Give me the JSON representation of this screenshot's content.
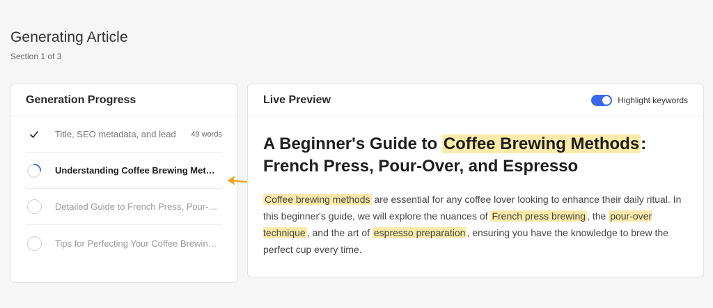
{
  "header": {
    "title": "Generating Article",
    "subtitle": "Section 1 of 3"
  },
  "progress": {
    "title": "Generation Progress",
    "steps": [
      {
        "label": "Title, SEO metadata, and lead",
        "status": "done",
        "count": "49 words",
        "icon": "check-icon"
      },
      {
        "label": "Understanding Coffee Brewing Met…",
        "status": "active",
        "icon": "spinner-icon"
      },
      {
        "label": "Detailed Guide to French Press, Pour-O…",
        "status": "pending",
        "icon": "empty-circle-icon"
      },
      {
        "label": "Tips for Perfecting Your Coffee Brewin…",
        "status": "pending",
        "icon": "empty-circle-icon"
      }
    ]
  },
  "preview": {
    "title": "Live Preview",
    "toggle": {
      "label": "Highlight keywords",
      "on": true,
      "color": "#3b68e8"
    },
    "article": {
      "title_pre": "A Beginner's Guide to ",
      "title_kw": "Coffee Brewing Methods",
      "title_post": ": French Press, Pour-Over, and Espresso",
      "para": {
        "kw1": "Coffee brewing methods",
        "t1": " are essential for any coffee lover looking to enhance their daily ritual. In this beginner's guide, we will explore the nuances of ",
        "kw2": "French press brewing",
        "t2": ", the ",
        "kw3": "pour-over technique",
        "t3": ", and the art of ",
        "kw4": "espresso preparation",
        "t4": ", ensuring you have the knowledge to brew the perfect cup every time."
      }
    },
    "highlight_color": "#fbeaa9"
  },
  "accent_arrow_color": "#f5a623"
}
